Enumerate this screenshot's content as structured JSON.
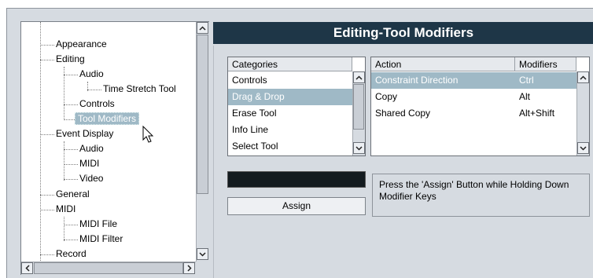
{
  "tree": {
    "items": [
      {
        "label": "Appearance",
        "level": 1
      },
      {
        "label": "Editing",
        "level": 1
      },
      {
        "label": "Audio",
        "level": 2
      },
      {
        "label": "Time Stretch Tool",
        "level": 3
      },
      {
        "label": "Controls",
        "level": 2
      },
      {
        "label": "Tool Modifiers",
        "level": 2,
        "selected": true
      },
      {
        "label": "Event Display",
        "level": 1
      },
      {
        "label": "Audio",
        "level": 2
      },
      {
        "label": "MIDI",
        "level": 2
      },
      {
        "label": "Video",
        "level": 2
      },
      {
        "label": "General",
        "level": 1
      },
      {
        "label": "MIDI",
        "level": 1
      },
      {
        "label": "MIDI File",
        "level": 2
      },
      {
        "label": "MIDI Filter",
        "level": 2
      },
      {
        "label": "Record",
        "level": 1
      }
    ]
  },
  "panel": {
    "title": "Editing-Tool Modifiers"
  },
  "categories": {
    "header": "Categories",
    "items": [
      "Controls",
      "Drag & Drop",
      "Erase Tool",
      "Info Line",
      "Select Tool"
    ],
    "selected_index": 1
  },
  "actions": {
    "header_action": "Action",
    "header_modifiers": "Modifiers",
    "rows": [
      {
        "action": "Constraint Direction",
        "modifiers": "Ctrl",
        "selected": true
      },
      {
        "action": "Copy",
        "modifiers": "Alt"
      },
      {
        "action": "Shared Copy",
        "modifiers": "Alt+Shift"
      }
    ]
  },
  "assign_label": "Assign",
  "hint_text": "Press the 'Assign' Button while Holding Down Modifier Keys",
  "colors": {
    "title_bar": "#1e3647",
    "selection": "#9fb9c6",
    "panel_bg": "#d6dbe1"
  }
}
